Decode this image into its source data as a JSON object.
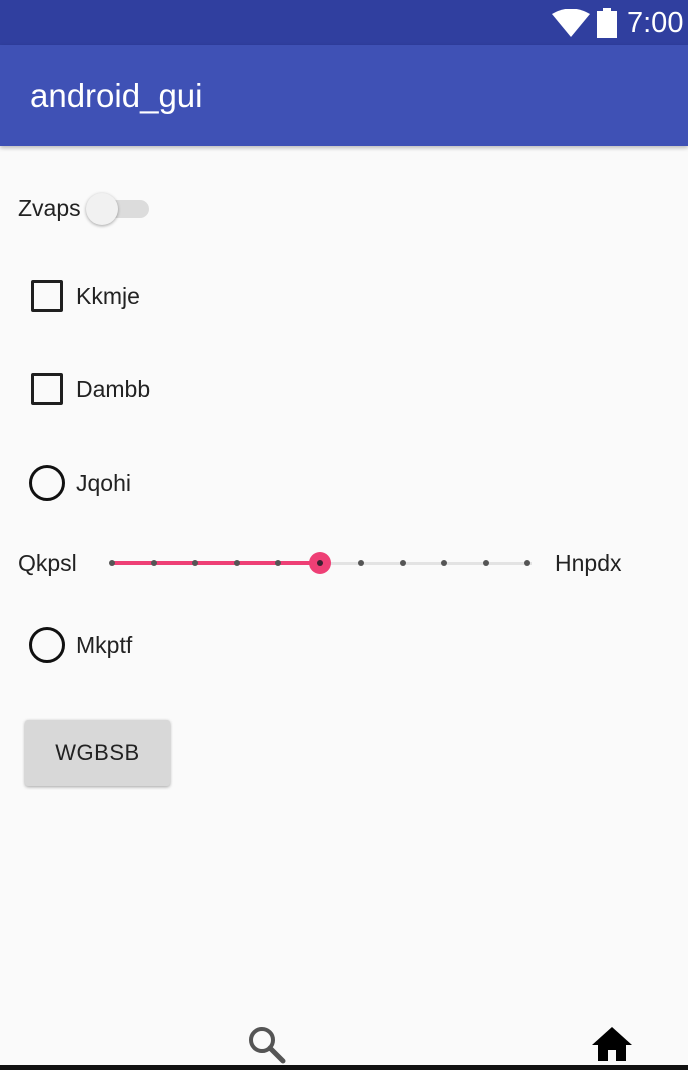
{
  "status_bar": {
    "time": "7:00",
    "icons": [
      "wifi-icon",
      "battery-icon"
    ]
  },
  "app_bar": {
    "title": "android_gui"
  },
  "switch": {
    "label": "Zvaps",
    "checked": false
  },
  "checkboxes": [
    {
      "label": "Kkmje",
      "checked": false
    },
    {
      "label": "Dambb",
      "checked": false
    }
  ],
  "radios": [
    {
      "label": "Jqohi",
      "selected": false
    },
    {
      "label": "Mkptf",
      "selected": false
    }
  ],
  "slider": {
    "label_left": "Qkpsl",
    "label_right": "Hnpdx",
    "steps": 10,
    "value": 5
  },
  "button": {
    "label": "WGBSB"
  },
  "bottom_nav": {
    "items": [
      "search-icon",
      "home-icon"
    ]
  },
  "colors": {
    "status_bar": "#303f9f",
    "app_bar": "#3f51b5",
    "accent": "#ee3f75",
    "background": "#fafafa"
  }
}
